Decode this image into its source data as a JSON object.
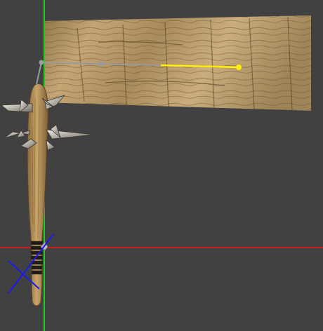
{
  "viewport": {
    "background_color": "#414141",
    "axis_x_color": "#cc1a1a",
    "axis_y_color": "#22cc22",
    "bone_color": "#9a9a9a",
    "selected_bone_color": "#ffee00",
    "ik_target_color": "#1a1aee"
  },
  "texture_plane": {
    "icon": "wood-texture-plane",
    "base_color": "#b99a68"
  },
  "club": {
    "icon": "spiked-club-mesh",
    "wood_color": "#b98f56",
    "spike_color": "#c9c2b6",
    "grip_color": "#1e1b17"
  },
  "gizmo": {
    "icon": "ik-target-cross-icon"
  }
}
